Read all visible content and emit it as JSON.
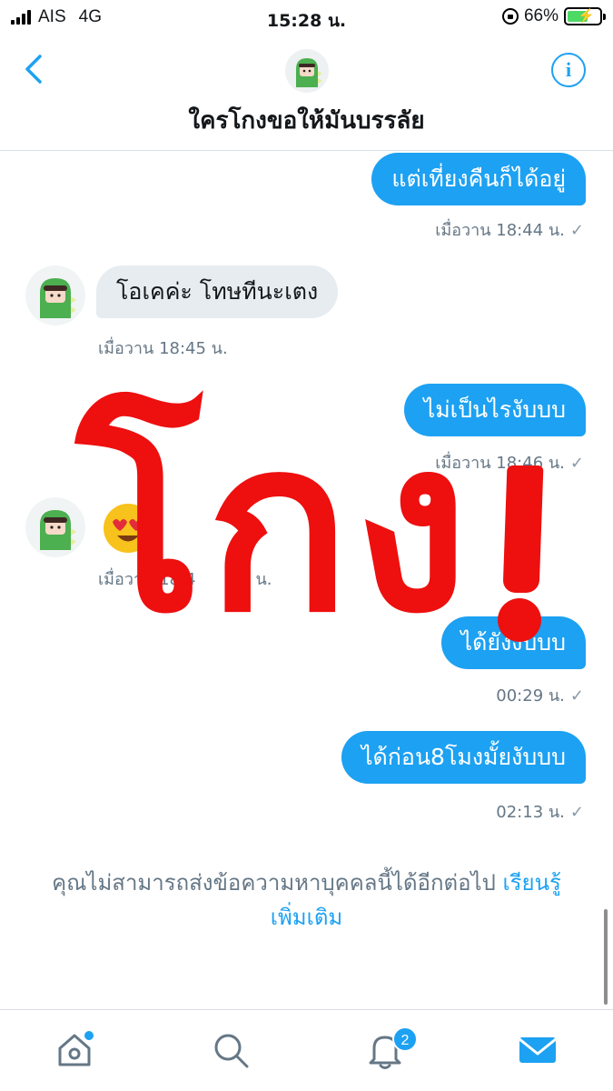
{
  "status_bar": {
    "carrier": "AIS",
    "network": "4G",
    "time": "15:28 น.",
    "battery": "66%",
    "battery_level": 0.66
  },
  "header": {
    "title": "ใครโกงขอให้มันบรรลัย",
    "info_label": "i"
  },
  "messages": [
    {
      "direction": "out",
      "text": "แต่เที่ยงคืนก็ได้อยู่",
      "meta": "เมื่อวาน 18:44 น."
    },
    {
      "direction": "in",
      "text": "โอเคค่ะ โทษทีนะเตง",
      "meta": "เมื่อวาน 18:45 น."
    },
    {
      "direction": "out",
      "text": "ไม่เป็นไรงับบบ",
      "meta": "เมื่อวาน 18:46 น."
    },
    {
      "direction": "in",
      "text": "",
      "emoji": "heart-eyes-emoji",
      "meta": "เมื่อวาน 18:4"
    },
    {
      "direction": "out",
      "text": "ได้ยังงับบบ",
      "meta": "00:29 น."
    },
    {
      "direction": "out",
      "text": "ได้ก่อน8โมงมั้ยงับบบ",
      "meta": "02:13 น."
    }
  ],
  "read_mark": "✓",
  "meta_tail_partial": "น.",
  "notice": {
    "text": "คุณไม่สามารถส่งข้อความหาบุคคลนี้ได้อีกต่อไป",
    "link_part1": "เรียนรู้",
    "link_part2": "เพิ่มเติม"
  },
  "overlay": {
    "stamp_text": "โกง",
    "color": "#ee0f0f"
  },
  "tab_bar": {
    "tabs": [
      "home-icon",
      "search-icon",
      "bell-icon",
      "mail-icon"
    ],
    "notifications_badge": "2"
  },
  "colors": {
    "accent": "#1da1f2",
    "incoming_bubble": "#e6ecf0",
    "meta_text": "#657786"
  }
}
